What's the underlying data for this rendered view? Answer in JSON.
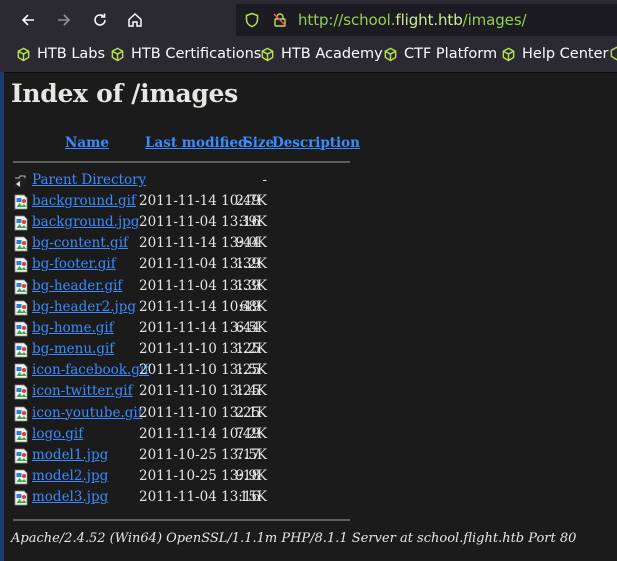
{
  "browser": {
    "url_prefix": "http://school.",
    "url_domain": "flight.htb",
    "url_path": "/images/"
  },
  "bookmarks": [
    {
      "label": "HTB Labs",
      "icon": "cube-icon"
    },
    {
      "label": "HTB Certifications",
      "icon": "cube-icon"
    },
    {
      "label": "HTB Academy",
      "icon": "cube-icon"
    },
    {
      "label": "CTF Platform",
      "icon": "cube-icon"
    },
    {
      "label": "Help Center",
      "icon": "cube-icon"
    }
  ],
  "colors": {
    "link": "#3a8bff",
    "bookmark_icon": "#b6e34d",
    "url": "#8fd14f"
  },
  "page": {
    "title": "Index of /images",
    "headers": {
      "name": "Name",
      "last_modified": "Last modified",
      "size": "Size",
      "description": "Description"
    },
    "parent": {
      "name": "Parent Directory",
      "size": "-"
    },
    "files": [
      {
        "name": "background.gif",
        "date": "2011-11-14 10:49",
        "size": "2.7K"
      },
      {
        "name": "background.jpg",
        "date": "2011-11-04 13:16",
        "size": "39K"
      },
      {
        "name": "bg-content.gif",
        "date": "2011-11-14 13:44",
        "size": "9.0K"
      },
      {
        "name": "bg-footer.gif",
        "date": "2011-11-04 13:39",
        "size": "1.2K"
      },
      {
        "name": "bg-header.gif",
        "date": "2011-11-04 13:39",
        "size": "1.3K"
      },
      {
        "name": "bg-header2.jpg",
        "date": "2011-11-14 10:49",
        "size": "68K"
      },
      {
        "name": "bg-home.gif",
        "date": "2011-11-14 13:44",
        "size": "6.5K"
      },
      {
        "name": "bg-menu.gif",
        "date": "2011-11-10 13:25",
        "size": "1.2K"
      },
      {
        "name": "icon-facebook.gif",
        "date": "2011-11-10 13:25",
        "size": "1.5K"
      },
      {
        "name": "icon-twitter.gif",
        "date": "2011-11-10 13:25",
        "size": "1.4K"
      },
      {
        "name": "icon-youtube.gif",
        "date": "2011-11-10 13:25",
        "size": "2.1K"
      },
      {
        "name": "logo.gif",
        "date": "2011-11-14 10:49",
        "size": "7.2K"
      },
      {
        "name": "model1.jpg",
        "date": "2011-10-25 13:17",
        "size": "7.5K"
      },
      {
        "name": "model2.jpg",
        "date": "2011-10-25 13:18",
        "size": "9.9K"
      },
      {
        "name": "model3.jpg",
        "date": "2011-11-04 13:16",
        "size": "15K"
      }
    ],
    "address": "Apache/2.4.52 (Win64) OpenSSL/1.1.1m PHP/8.1.1 Server at school.flight.htb Port 80"
  }
}
